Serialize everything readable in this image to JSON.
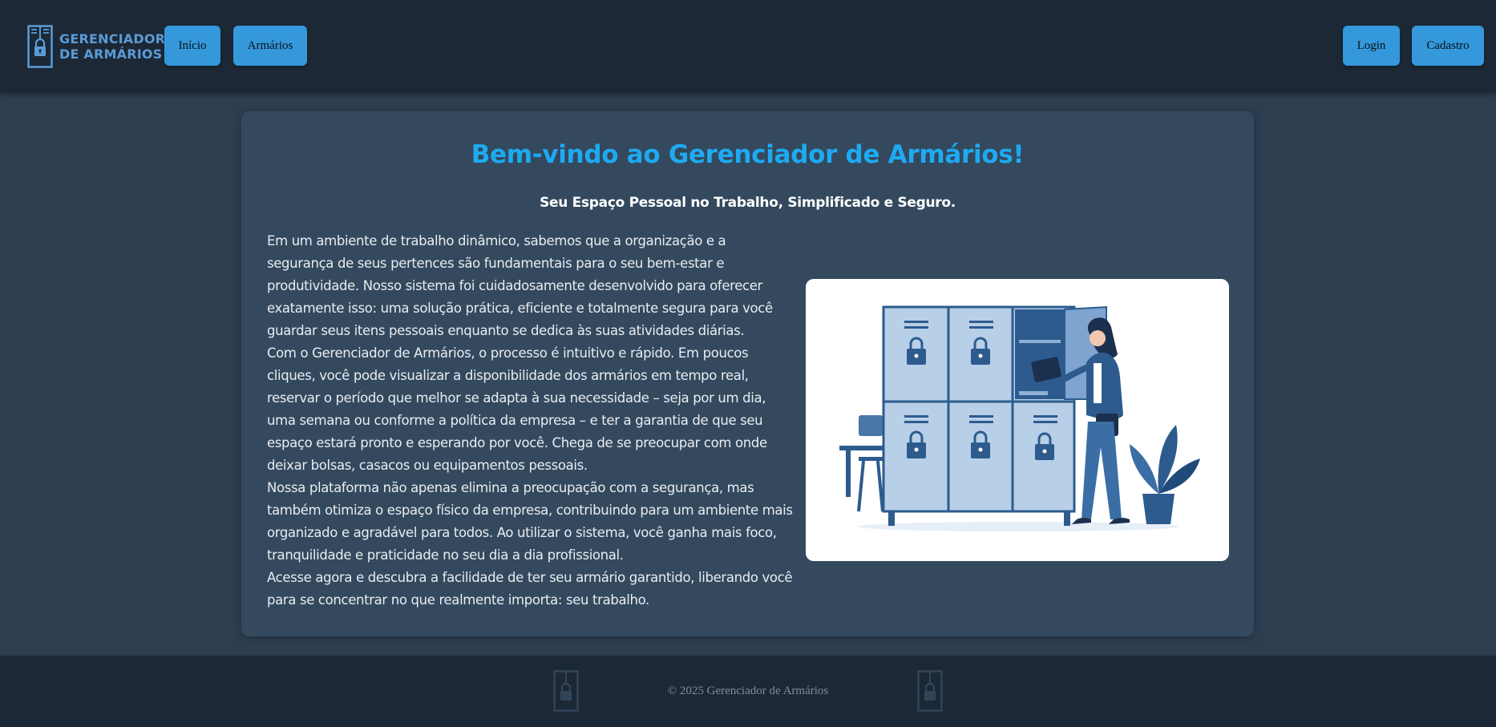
{
  "header": {
    "logo": {
      "line1": "GERENCIADOR",
      "line2": "DE ARMÁRIOS",
      "icon": "locker-icon"
    },
    "nav": {
      "inicio": "Início",
      "armarios": "Armários",
      "login": "Login",
      "cadastro": "Cadastro"
    }
  },
  "main": {
    "title": "Bem-vindo ao Gerenciador de Armários!",
    "subtitle": "Seu Espaço Pessoal no Trabalho, Simplificado e Seguro.",
    "paragraphs": [
      "Em um ambiente de trabalho dinâmico, sabemos que a organização e a segurança de seus pertences são fundamentais para o seu bem-estar e produtividade. Nosso sistema foi cuidadosamente desenvolvido para oferecer exatamente isso: uma solução prática, eficiente e totalmente segura para você guardar seus itens pessoais enquanto se dedica às suas atividades diárias.",
      "Com o Gerenciador de Armários, o processo é intuitivo e rápido. Em poucos cliques, você pode visualizar a disponibilidade dos armários em tempo real, reservar o período que melhor se adapta à sua necessidade – seja por um dia, uma semana ou conforme a política da empresa – e ter a garantia de que seu espaço estará pronto e esperando por você. Chega de se preocupar com onde deixar bolsas, casacos ou equipamentos pessoais.",
      "Nossa plataforma não apenas elimina a preocupação com a segurança, mas também otimiza o espaço físico da empresa, contribuindo para um ambiente mais organizado e agradável para todos. Ao utilizar o sistema, você ganha mais foco, tranquilidade e praticidade no seu dia a dia profissional.",
      "Acesse agora e descubra a facilidade de ter seu armário garantido, liberando você para se concentrar no que realmente importa: seu trabalho."
    ],
    "illustration": "woman-at-locker-illustration"
  },
  "footer": {
    "copyright": "© 2025 Gerenciador de Armários"
  },
  "colors": {
    "header_bg": "#1c2836",
    "page_bg": "#2c3e50",
    "card_bg": "#34495e",
    "accent": "#3498db",
    "title": "#1eaaf1"
  }
}
